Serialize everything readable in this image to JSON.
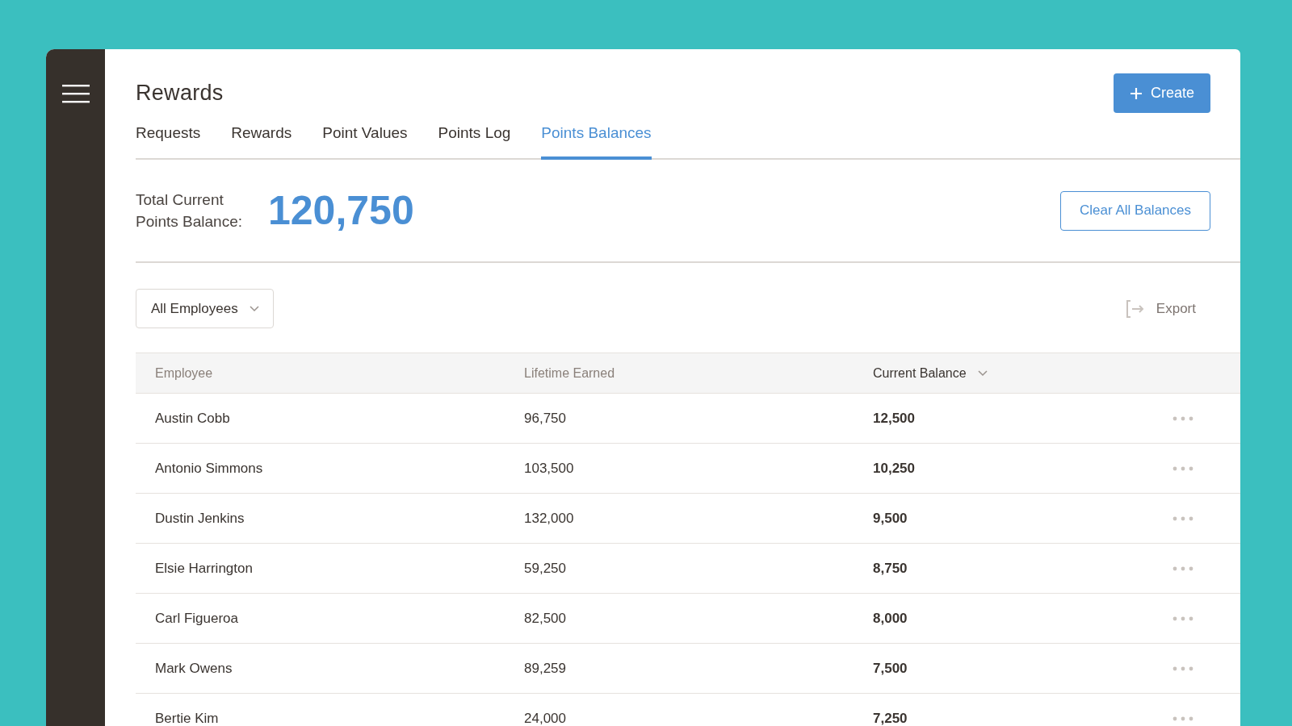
{
  "page": {
    "title": "Rewards",
    "create_button": "Create"
  },
  "tabs": [
    {
      "label": "Requests",
      "selected": false
    },
    {
      "label": "Rewards",
      "selected": false
    },
    {
      "label": "Point Values",
      "selected": false
    },
    {
      "label": "Points Log",
      "selected": false
    },
    {
      "label": "Points Balances",
      "selected": true
    }
  ],
  "summary": {
    "label": "Total Current Points Balance:",
    "value": "120,750",
    "clear_button": "Clear All Balances"
  },
  "toolbar": {
    "filter": "All Employees",
    "export": "Export"
  },
  "table": {
    "columns": [
      {
        "label": "Employee",
        "sorted": false
      },
      {
        "label": "Lifetime Earned",
        "sorted": false
      },
      {
        "label": "Current Balance",
        "sorted": true
      }
    ],
    "rows": [
      {
        "employee": "Austin Cobb",
        "lifetime": "96,750",
        "current": "12,500"
      },
      {
        "employee": "Antonio Simmons",
        "lifetime": "103,500",
        "current": "10,250"
      },
      {
        "employee": "Dustin Jenkins",
        "lifetime": "132,000",
        "current": "9,500"
      },
      {
        "employee": "Elsie Harrington",
        "lifetime": "59,250",
        "current": "8,750"
      },
      {
        "employee": "Carl Figueroa",
        "lifetime": "82,500",
        "current": "8,000"
      },
      {
        "employee": "Mark Owens",
        "lifetime": "89,259",
        "current": "7,500"
      },
      {
        "employee": "Bertie Kim",
        "lifetime": "24,000",
        "current": "7,250"
      }
    ]
  }
}
